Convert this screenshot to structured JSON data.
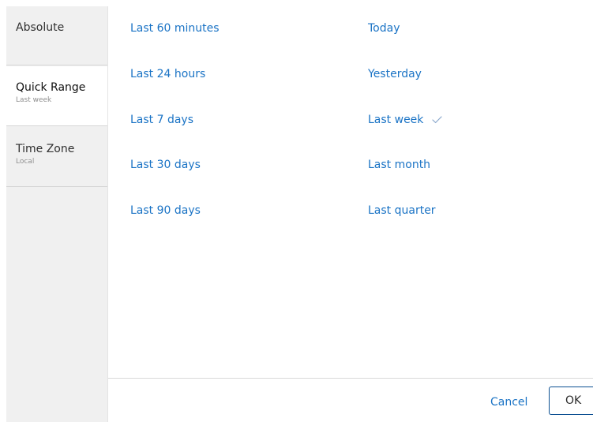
{
  "sidebar": {
    "items": [
      {
        "label": "Absolute",
        "sublabel": ""
      },
      {
        "label": "Quick Range",
        "sublabel": "Last week"
      },
      {
        "label": "Time Zone",
        "sublabel": "Local"
      }
    ]
  },
  "ranges": {
    "left": [
      "Last 60 minutes",
      "Last 24 hours",
      "Last 7 days",
      "Last 30 days",
      "Last 90 days"
    ],
    "right": [
      "Today",
      "Yesterday",
      "Last week",
      "Last month",
      "Last quarter"
    ],
    "selected": "Last week"
  },
  "footer": {
    "cancel_label": "Cancel",
    "ok_label": "OK"
  },
  "colors": {
    "link": "#1a73c5",
    "sidebar_bg": "#f0f0f0",
    "active_bg": "#ffffff",
    "ok_border": "#0b4f91",
    "check": "#8aa7cc"
  },
  "icons": {
    "selected_marker": "check-icon"
  }
}
